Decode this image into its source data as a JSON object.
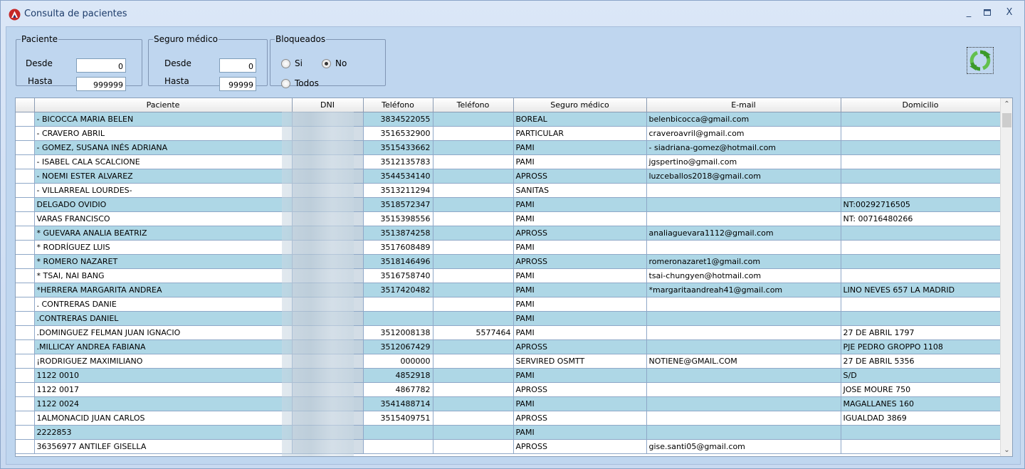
{
  "window": {
    "title": "Consulta de pacientes"
  },
  "filters": {
    "paciente": {
      "legend": "Paciente",
      "desde_label": "Desde",
      "desde_value": "0",
      "hasta_label": "Hasta",
      "hasta_value": "999999"
    },
    "seguro": {
      "legend": "Seguro médico",
      "desde_label": "Desde",
      "desde_value": "0",
      "hasta_label": "Hasta",
      "hasta_value": "99999"
    },
    "bloqueados": {
      "legend": "Bloqueados",
      "options": [
        "Si",
        "No",
        "Todos"
      ],
      "selected": "No"
    }
  },
  "icons": {
    "refresh": "refresh-icon",
    "app": "app-logo-icon",
    "minimize": "minimize-icon",
    "maximize": "maximize-icon",
    "close": "close-icon"
  },
  "colors": {
    "row_alt": "#aed7e6",
    "accent": "#3c9a2a"
  },
  "grid": {
    "columns": [
      "Paciente",
      "DNI",
      "Teléfono",
      "Teléfono",
      "Seguro médico",
      "E-mail",
      "Domicilio"
    ],
    "rows": [
      [
        "- BICOCCA MARIA BELEN",
        "",
        "3834522055",
        "",
        "BOREAL",
        "belenbicocca@gmail.com",
        ""
      ],
      [
        "- CRAVERO ABRIL",
        "",
        "3516532900",
        "",
        "PARTICULAR",
        "craveroavril@gmail.com",
        ""
      ],
      [
        "- GOMEZ, SUSANA INÉS ADRIANA",
        "",
        "3515433662",
        "",
        "PAMI",
        "- siadriana-gomez@hotmail.com",
        ""
      ],
      [
        "- ISABEL CALA SCALCIONE",
        "",
        "3512135783",
        "",
        "PAMI",
        "jgspertino@gmail.com",
        ""
      ],
      [
        "- NOEMI ESTER ALVAREZ",
        "",
        "3544534140",
        "",
        "APROSS",
        "luzceballos2018@gmail.com",
        ""
      ],
      [
        "- VILLARREAL LOURDES-",
        "",
        "3513211294",
        "",
        "SANITAS",
        "",
        ""
      ],
      [
        "DELGADO OVIDIO",
        "",
        "3518572347",
        "",
        "PAMI",
        "",
        "NT:00292716505"
      ],
      [
        "VARAS FRANCISCO",
        "",
        "3515398556",
        "",
        "PAMI",
        "",
        "NT: 00716480266"
      ],
      [
        "* GUEVARA ANALIA BEATRIZ",
        "",
        "3513874258",
        "",
        "APROSS",
        " analiaguevara1112@gmail.com",
        ""
      ],
      [
        "* RODRÍGUEZ LUIS",
        "",
        "3517608489",
        "",
        "PAMI",
        "",
        ""
      ],
      [
        "* ROMERO NAZARET",
        "",
        "3518146496",
        "",
        "APROSS",
        "romeronazaret1@gmail.com",
        ""
      ],
      [
        "* TSAI, NAI BANG",
        "",
        "3516758740",
        "",
        "PAMI",
        "tsai-chungyen@hotmail.com",
        ""
      ],
      [
        "*HERRERA MARGARITA ANDREA",
        "",
        "3517420482",
        "",
        "PAMI",
        "*margaritaandreah41@gmail.com",
        "LINO NEVES 657 LA MADRID"
      ],
      [
        ". CONTRERAS DANIE",
        "",
        "",
        "",
        "PAMI",
        "",
        ""
      ],
      [
        ".CONTRERAS DANIEL",
        "",
        "",
        "",
        "PAMI",
        "",
        ""
      ],
      [
        ".DOMINGUEZ FELMAN JUAN IGNACIO",
        "",
        "3512008138",
        "5577464",
        "PAMI",
        "",
        "27 DE ABRIL 1797"
      ],
      [
        ".MILLICAY ANDREA FABIANA",
        "",
        "3512067429",
        "",
        "APROSS",
        "",
        "PJE PEDRO GROPPO 1108"
      ],
      [
        "¡RODRIGUEZ MAXIMILIANO",
        "",
        "000000",
        "",
        "SERVIRED OSMTT",
        "NOTIENE@GMAIL.COM",
        "27 DE ABRIL 5356"
      ],
      [
        "1122 0010",
        "",
        "4852918",
        "",
        "PAMI",
        "",
        "S/D"
      ],
      [
        "1122 0017",
        "",
        "4867782",
        "",
        "APROSS",
        "",
        "JOSE MOURE 750"
      ],
      [
        "1122 0024",
        "",
        "3541488714",
        "",
        "PAMI",
        "",
        "MAGALLANES 160"
      ],
      [
        "1ALMONACID JUAN CARLOS",
        "",
        "3515409751",
        "",
        "APROSS",
        "",
        "IGUALDAD 3869"
      ],
      [
        "2222853",
        "",
        "",
        "",
        "PAMI",
        "",
        ""
      ],
      [
        "36356977 ANTILEF GISELLA",
        "",
        "",
        "",
        "APROSS",
        "gise.santi05@gmail.com",
        ""
      ]
    ]
  }
}
